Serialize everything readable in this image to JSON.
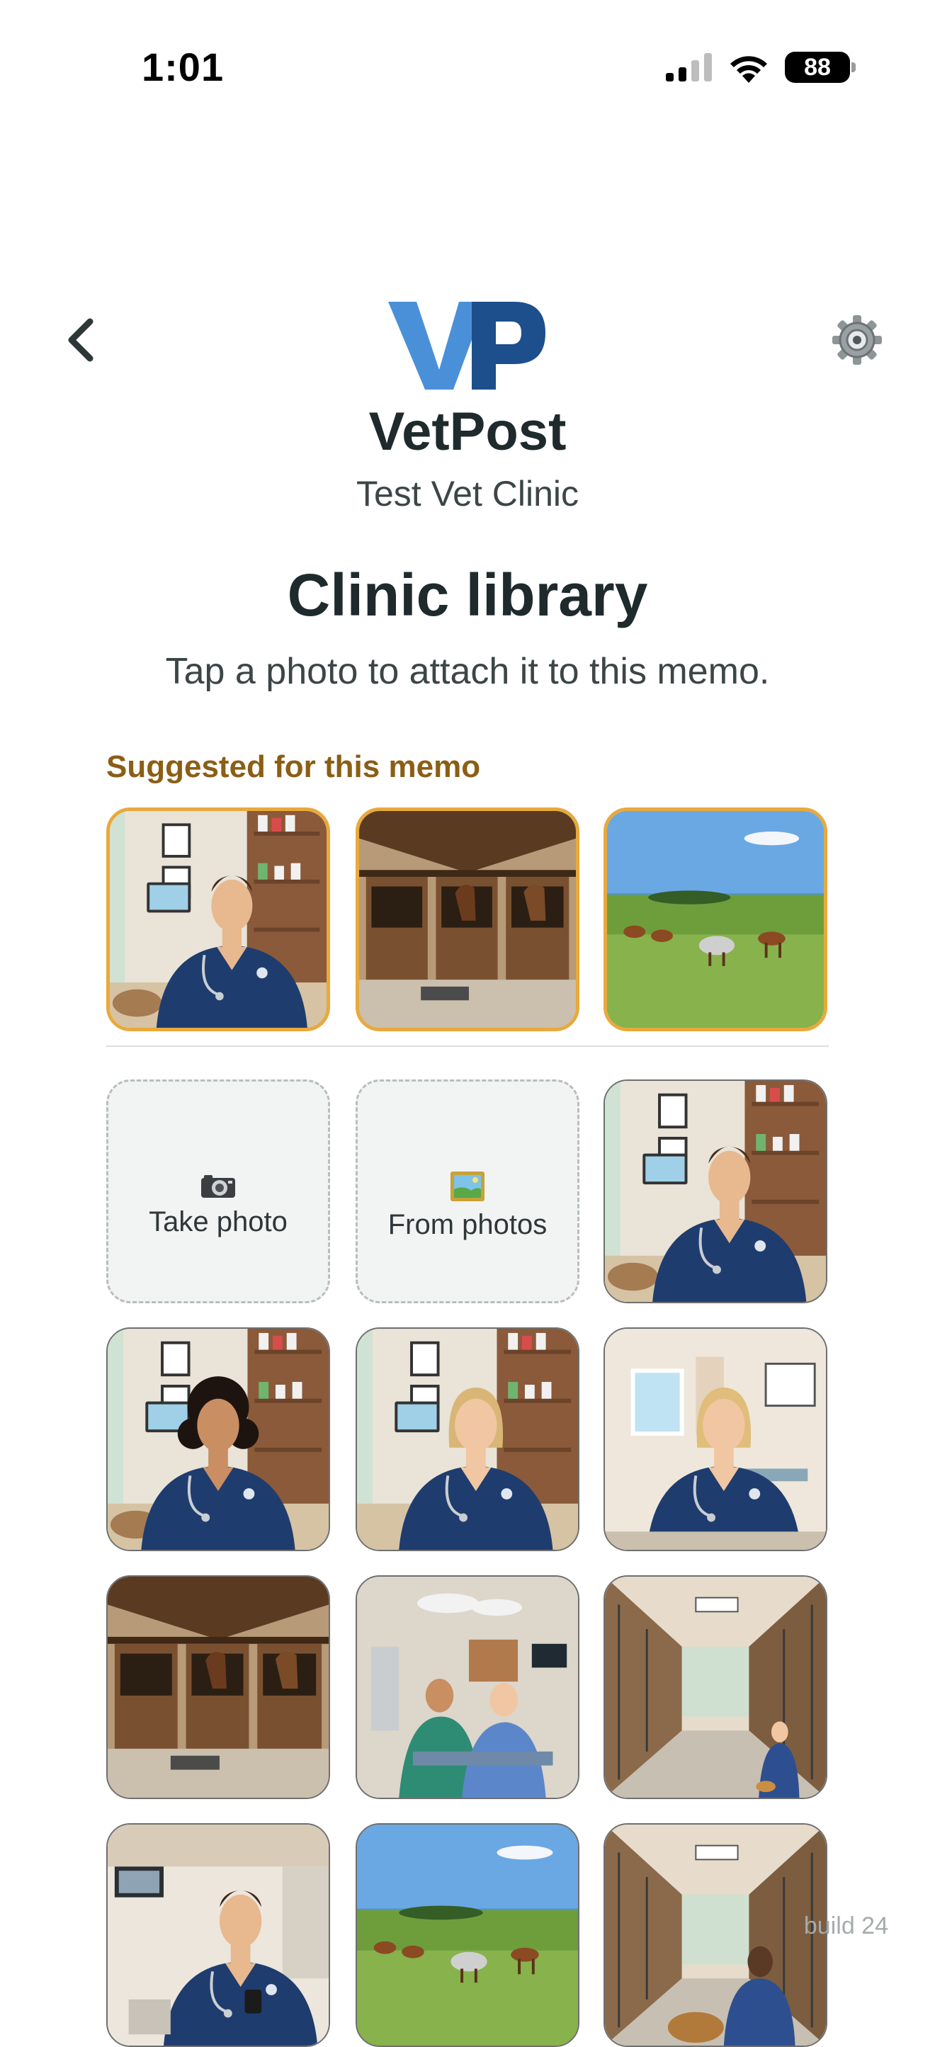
{
  "status_bar": {
    "time": "1:01",
    "battery": "88"
  },
  "header": {
    "logo_text": "VP",
    "app_name": "VetPost",
    "clinic_name": "Test Vet Clinic"
  },
  "page": {
    "title": "Clinic library",
    "subtitle": "Tap a photo to attach it to this memo."
  },
  "suggested": {
    "label": "Suggested for this memo",
    "photos": [
      {
        "scene": "vet-portrait-man"
      },
      {
        "scene": "barn-stalls"
      },
      {
        "scene": "horses-pasture"
      }
    ]
  },
  "actions": {
    "take_photo_label": "Take photo",
    "take_photo_icon": "camera-icon",
    "from_photos_label": "From photos",
    "from_photos_icon": "picture-icon"
  },
  "library": {
    "photos": [
      {
        "scene": "vet-portrait-man"
      },
      {
        "scene": "vet-portrait-woman-curly"
      },
      {
        "scene": "vet-portrait-woman-blonde"
      },
      {
        "scene": "exam-room"
      },
      {
        "scene": "barn-stalls"
      },
      {
        "scene": "surgery-room"
      },
      {
        "scene": "kennel-hallway"
      },
      {
        "scene": "vet-man-phone"
      },
      {
        "scene": "horses-pasture"
      },
      {
        "scene": "kennel-dog"
      }
    ]
  },
  "footer": {
    "build": "build 24"
  },
  "colors": {
    "accent_gold": "#e8a93d",
    "label_gold": "#8b5e15",
    "logo_light_blue": "#4a90d9",
    "logo_dark_blue": "#1d4f8c"
  }
}
